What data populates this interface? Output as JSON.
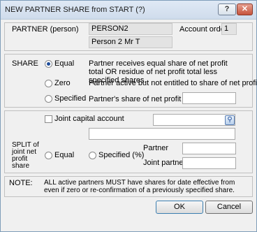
{
  "window": {
    "title": "NEW PARTNER SHARE from START (?)",
    "help_label": "?",
    "close_label": "✕"
  },
  "partner": {
    "label": "PARTNER (person)",
    "code": "PERSON2",
    "account_order_label": "Account order",
    "account_order": "1",
    "name": "Person 2  Mr T"
  },
  "share": {
    "label": "SHARE",
    "options": [
      {
        "label": "Equal",
        "desc": "Partner receives equal share of net profit total OR residue of net profit total less specified shares.",
        "selected": true
      },
      {
        "label": "Zero",
        "desc": "Partner active but not entitled to share of net profit.",
        "selected": false
      },
      {
        "label": "Specified",
        "desc": "Partner's share of net profit (%)",
        "selected": false
      }
    ],
    "specified_value": ""
  },
  "capital": {
    "joint_label": "Joint capital account",
    "joint_checked": false,
    "account_value": "",
    "description_value": ""
  },
  "split": {
    "label": "SPLIT of joint net profit share",
    "equal_label": "Equal",
    "specified_label": "Specified (%)",
    "partner_label": "Partner",
    "joint_partner_label": "Joint partner",
    "partner_value": "",
    "joint_partner_value": ""
  },
  "note": {
    "label": "NOTE:",
    "text": "ALL active partners MUST have shares for date effective from even if zero or re-confirmation of a previously specified share."
  },
  "buttons": {
    "ok": "OK",
    "cancel": "Cancel"
  },
  "icons": {
    "lookup": "search-icon"
  }
}
